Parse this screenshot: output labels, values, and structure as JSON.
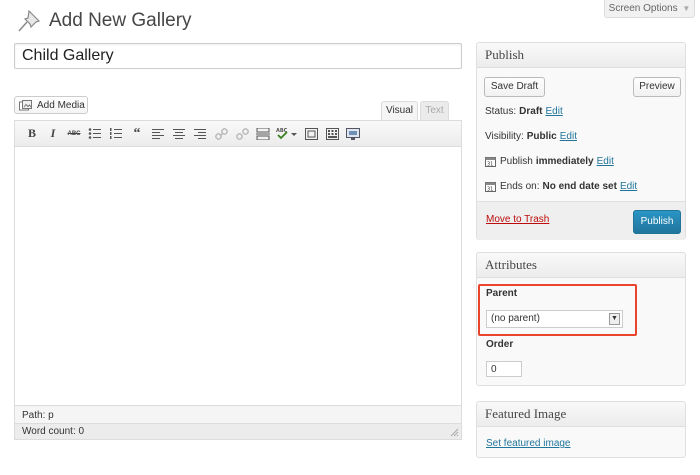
{
  "screen_options": {
    "label": "Screen Options",
    "arrow": "▼"
  },
  "header": {
    "title": "Add New Gallery",
    "icon": "pushpin-icon"
  },
  "title_field": {
    "value": "Child Gallery"
  },
  "editor": {
    "add_media_label": "Add Media",
    "tabs": [
      {
        "label": "Visual",
        "active": true
      },
      {
        "label": "Text",
        "active": false
      }
    ],
    "toolbar": [
      "bold",
      "italic",
      "strikethrough",
      "bullet-list",
      "numbered-list",
      "blockquote",
      "align-left",
      "align-center",
      "align-right",
      "link",
      "unlink",
      "insert-more",
      "spellcheck",
      "fullscreen",
      "kitchen-sink",
      "distraction-free"
    ],
    "path": "Path: p",
    "word_count": "Word count: 0"
  },
  "publish": {
    "title": "Publish",
    "save_draft": "Save Draft",
    "preview": "Preview",
    "status_label": "Status:",
    "status_value": "Draft",
    "visibility_label": "Visibility:",
    "visibility_value": "Public",
    "publish_label": "Publish",
    "publish_value": "immediately",
    "ends_label": "Ends on:",
    "ends_value": "No end date set",
    "edit": "Edit",
    "move_to_trash": "Move to Trash",
    "publish_button": "Publish"
  },
  "attributes": {
    "title": "Attributes",
    "parent_label": "Parent",
    "parent_selected": "(no parent)",
    "order_label": "Order",
    "order_value": "0"
  },
  "featured_image": {
    "title": "Featured Image",
    "set_link": "Set featured image"
  },
  "colors": {
    "link": "#21759b",
    "publish_button": "#21759b",
    "trash": "#bc0b0b",
    "highlight": "#e8452c"
  }
}
